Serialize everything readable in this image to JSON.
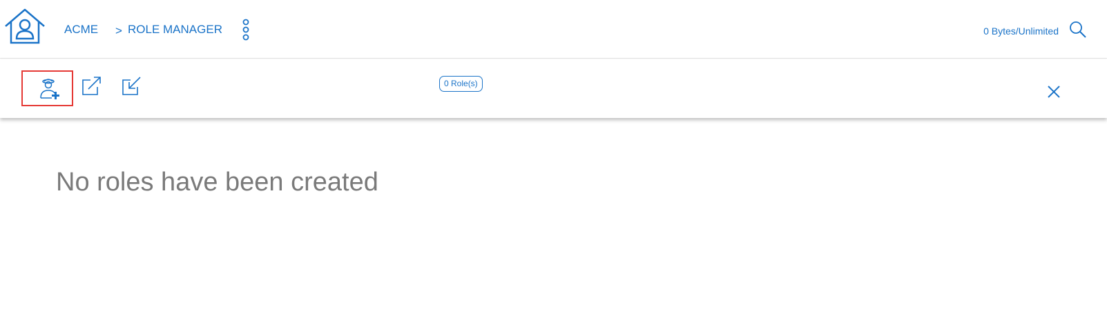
{
  "header": {
    "breadcrumb": {
      "org": "ACME",
      "separator": ">",
      "page": "ROLE MANAGER"
    },
    "storage": "0 Bytes/Unlimited",
    "icons": [
      "home-icon",
      "more-vertical-icon",
      "search-icon"
    ]
  },
  "toolbar": {
    "icons": [
      "add-role-icon",
      "export-icon",
      "import-icon",
      "close-icon"
    ],
    "role_count": "0 Role(s)"
  },
  "main": {
    "empty_message": "No roles have been created"
  },
  "colors": {
    "accent": "#1a73c8",
    "highlight": "#e53935",
    "muted_text": "#7a7a7a"
  }
}
